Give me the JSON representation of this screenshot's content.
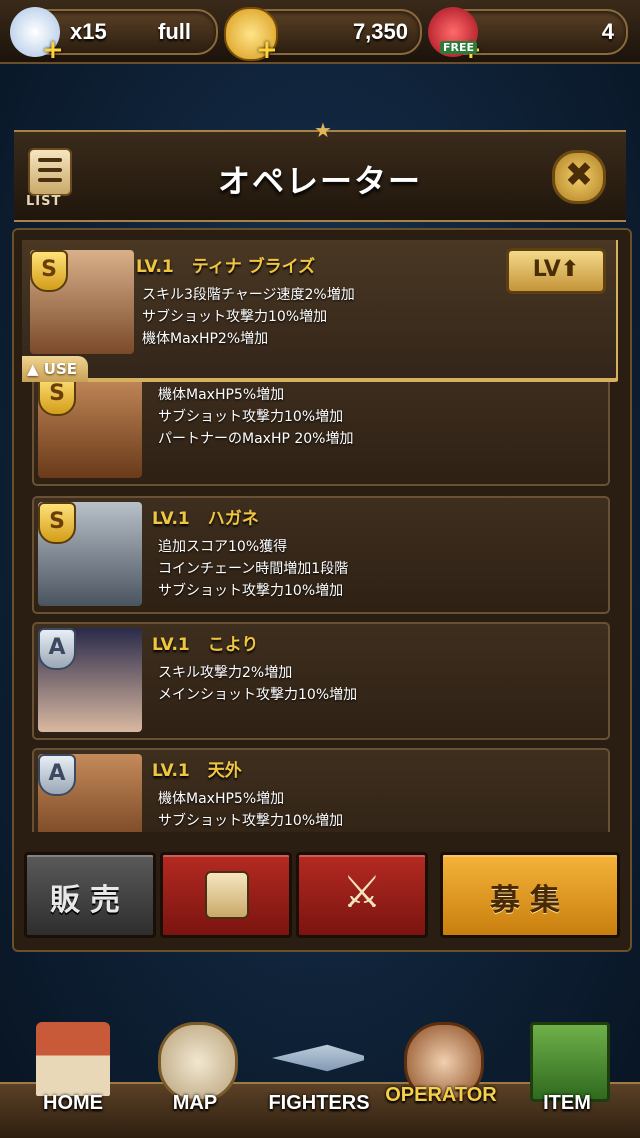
{
  "status": {
    "stamina_count": "x15",
    "stamina_state": "full",
    "gold": "7,350",
    "gems": "4",
    "gems_badge": "FREE"
  },
  "header": {
    "title": "オペレーター",
    "list_label": "LIST"
  },
  "operators": [
    {
      "level": "LV.1",
      "name": "ティナ ブライズ",
      "rank": "S",
      "skills": [
        "スキル3段階チャージ速度2%増加",
        "サブショット攻撃力10%増加",
        "機体MaxHP2%増加"
      ],
      "selected": true
    },
    {
      "level": "",
      "name": "",
      "rank": "S",
      "skills": [
        "機体MaxHP5%増加",
        "サブショット攻撃力10%増加",
        "パートナーのMaxHP 20%増加"
      ],
      "selected": false
    },
    {
      "level": "LV.1",
      "name": "ハガネ",
      "rank": "S",
      "skills": [
        "追加スコア10%獲得",
        "コインチェーン時間増加1段階",
        "サブショット攻撃力10%増加"
      ],
      "selected": false
    },
    {
      "level": "LV.1",
      "name": "こより",
      "rank": "A",
      "skills": [
        "スキル攻撃力2%増加",
        "メインショット攻撃力10%増加"
      ],
      "selected": false
    },
    {
      "level": "LV.1",
      "name": "天外",
      "rank": "A",
      "skills": [
        "機体MaxHP5%増加",
        "サブショット攻撃力10%増加"
      ],
      "selected": false
    }
  ],
  "selected_card": {
    "lv_button": "LV",
    "use_label": "USE"
  },
  "actions": {
    "sell": "販売",
    "recruit": "募集"
  },
  "nav": [
    {
      "label": "HOME",
      "icon": "house-icon"
    },
    {
      "label": "MAP",
      "icon": "globe-icon"
    },
    {
      "label": "FIGHTERS",
      "icon": "jet-icon"
    },
    {
      "label": "OPERATOR",
      "icon": "operator-icon",
      "active": true
    },
    {
      "label": "ITEM",
      "icon": "crate-icon"
    }
  ]
}
